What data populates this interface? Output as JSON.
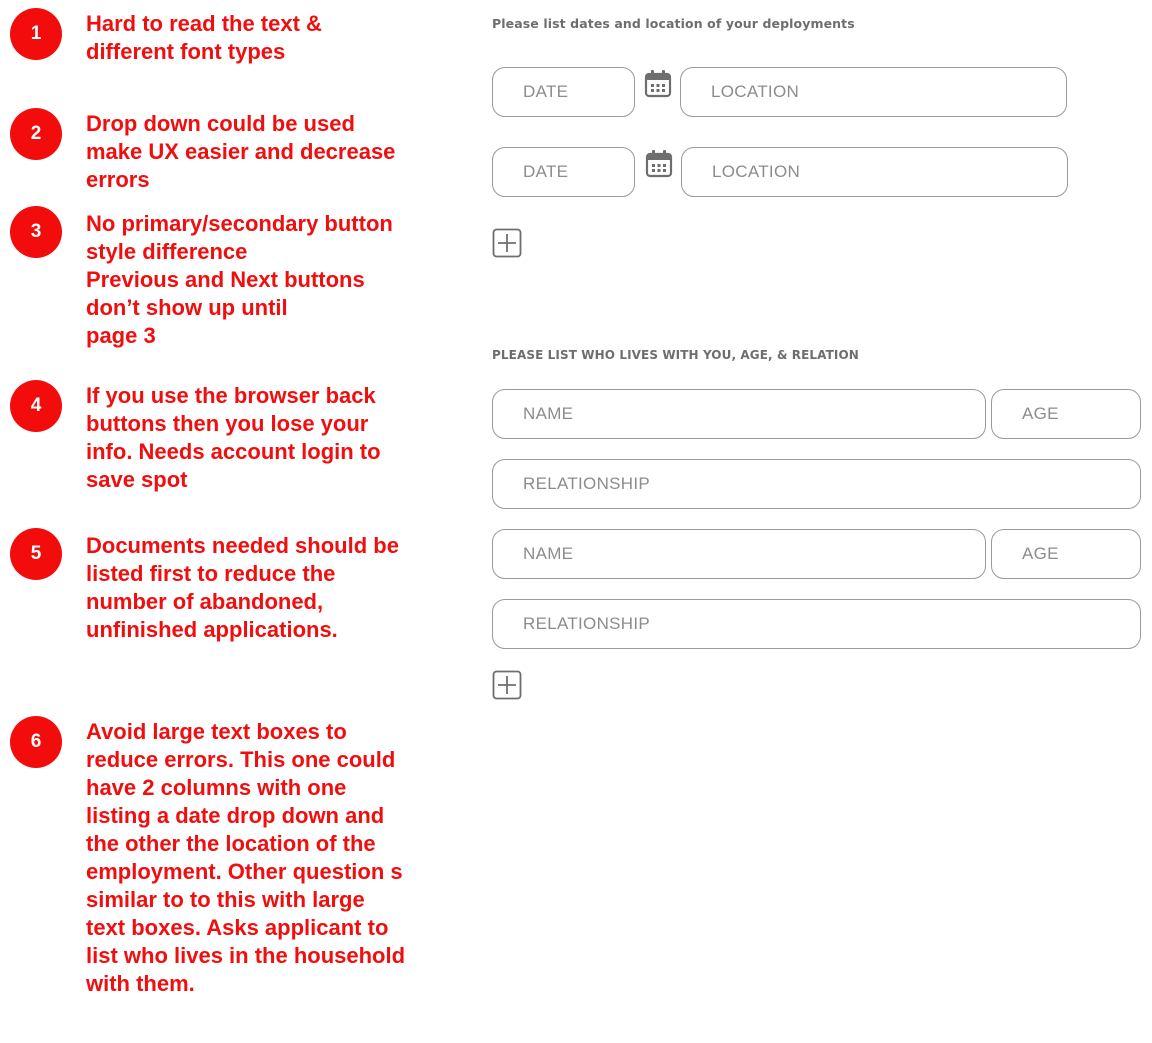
{
  "annotations": [
    {
      "number": "1",
      "text": "Hard to read the text &\ndifferent font types"
    },
    {
      "number": "2",
      "text": "Drop down could be used\nmake UX easier and decrease\nerrors"
    },
    {
      "number": "3",
      "text": "No primary/secondary button\nstyle difference\nPrevious and Next buttons\ndon’t show up until\npage 3"
    },
    {
      "number": "4",
      "text": "If you use the browser back\nbuttons then you lose your\ninfo.  Needs account login to\nsave spot"
    },
    {
      "number": "5",
      "text": "Documents needed should be\nlisted first to reduce the\nnumber of abandoned,\nunfinished applications."
    },
    {
      "number": "6",
      "text": "Avoid large text boxes to\nreduce errors.  This one could\nhave 2 columns with one\nlisting a date drop down and\nthe other the location of the\nemployment.  Other question s\nsimilar to to this with large\ntext boxes.  Asks applicant to\nlist who lives in the household\nwith them."
    }
  ],
  "deployments": {
    "title": "Please list dates and location of your deployments",
    "rows": [
      {
        "date_placeholder": "DATE",
        "location_placeholder": "LOCATION"
      },
      {
        "date_placeholder": "DATE",
        "location_placeholder": "LOCATION"
      }
    ]
  },
  "household": {
    "title": "PLEASE LIST WHO LIVES WITH YOU, AGE, & RELATION",
    "rows": [
      {
        "name_placeholder": "NAME",
        "age_placeholder": "AGE",
        "relationship_placeholder": "RELATIONSHIP"
      },
      {
        "name_placeholder": "NAME",
        "age_placeholder": "AGE",
        "relationship_placeholder": "RELATIONSHIP"
      }
    ]
  },
  "icons": {
    "calendar": "calendar-icon",
    "add": "plus-box-icon"
  },
  "colors": {
    "annotation_red": "#f00e0e",
    "badge_red": "#f30c0c",
    "field_border": "#9a9a9a",
    "placeholder_gray": "#8c8c8c",
    "title_gray": "#6e6e6e"
  }
}
